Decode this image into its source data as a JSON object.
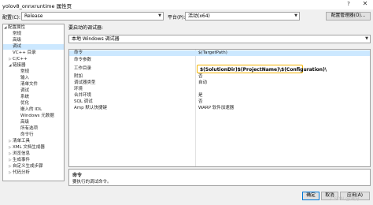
{
  "window": {
    "title": "yolov8_onnxruntime 属性页",
    "help_glyph": "?",
    "close_glyph": "✕"
  },
  "config_bar": {
    "config_label": "配置(C):",
    "config_value": "Release",
    "platform_label": "平台(P):",
    "platform_value": "活动(x64)",
    "manager_button": "配置管理器(O)..."
  },
  "tree": {
    "items": [
      {
        "label": "配置属性",
        "toggle": "◢"
      },
      {
        "label": "常规",
        "toggle": ""
      },
      {
        "label": "高级",
        "toggle": ""
      },
      {
        "label": "调试",
        "toggle": ""
      },
      {
        "label": "VC++ 目录",
        "toggle": ""
      },
      {
        "label": "C/C++",
        "toggle": "▷"
      },
      {
        "label": "链接器",
        "toggle": "◢"
      },
      {
        "label": "常规",
        "toggle": ""
      },
      {
        "label": "输入",
        "toggle": ""
      },
      {
        "label": "清单文件",
        "toggle": ""
      },
      {
        "label": "调试",
        "toggle": ""
      },
      {
        "label": "系统",
        "toggle": ""
      },
      {
        "label": "优化",
        "toggle": ""
      },
      {
        "label": "嵌入的 IDL",
        "toggle": ""
      },
      {
        "label": "Windows 元数据",
        "toggle": ""
      },
      {
        "label": "高级",
        "toggle": ""
      },
      {
        "label": "所有选项",
        "toggle": ""
      },
      {
        "label": "命令行",
        "toggle": ""
      },
      {
        "label": "清单工具",
        "toggle": "▷"
      },
      {
        "label": "XML 文档生成器",
        "toggle": "▷"
      },
      {
        "label": "浏览信息",
        "toggle": "▷"
      },
      {
        "label": "生成事件",
        "toggle": "▷"
      },
      {
        "label": "自定义生成步骤",
        "toggle": "▷"
      },
      {
        "label": "代码分析",
        "toggle": "▷"
      }
    ]
  },
  "debugger": {
    "heading": "要启动的调试器:",
    "selected": "本地 Windows 调试器"
  },
  "properties": {
    "rows": [
      {
        "key": "命令",
        "value": "$(TargetPath)"
      },
      {
        "key": "命令参数",
        "value": ""
      },
      {
        "key": "工作目录",
        "value": "$(SolutionDir)$(ProjectName)\\$(Configuration)\\"
      },
      {
        "key": "附加",
        "value": "否"
      },
      {
        "key": "调试器类型",
        "value": "自动"
      },
      {
        "key": "环境",
        "value": ""
      },
      {
        "key": "合并环境",
        "value": "是"
      },
      {
        "key": "SQL 调试",
        "value": "否"
      },
      {
        "key": "Amp 默认快捷键",
        "value": "WARP 软件加速器"
      }
    ]
  },
  "description": {
    "title": "命令",
    "text": "要执行的调试命令。"
  },
  "footer": {
    "ok": "确定",
    "cancel": "取消",
    "apply": "应用(A)",
    "watermark": "CSDN @满分"
  }
}
